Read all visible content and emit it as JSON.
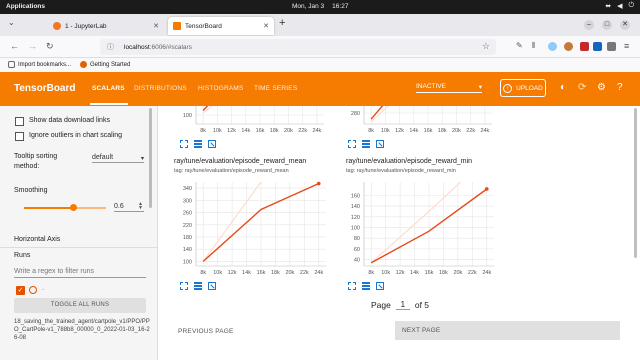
{
  "topbar": {
    "activities": "Applications",
    "date": "Mon, Jan 3",
    "time": "16:27"
  },
  "browser": {
    "tabs": [
      {
        "label": "1 - JupyterLab",
        "favicon_color": "#f37626"
      },
      {
        "label": "TensorBoard",
        "favicon_color": "#f57c00"
      }
    ],
    "url_host": "localhost",
    "url_rest": ":6006/#scalars",
    "bookmarks": [
      "Import bookmarks...",
      "Getting Started"
    ]
  },
  "header": {
    "brand": "TensorBoard",
    "nav": [
      "SCALARS",
      "DISTRIBUTIONS",
      "HISTOGRAMS",
      "TIME SERIES"
    ],
    "run_status": "INACTIVE",
    "upload_label": "UPLOAD"
  },
  "sidebar": {
    "show_download_links": "Show data download links",
    "ignore_outliers": "Ignore outliers in chart scaling",
    "tooltip_sorting_label": "Tooltip sorting method:",
    "tooltip_sorting_value": "default",
    "smoothing_label": "Smoothing",
    "smoothing_value": "0.6",
    "smoothing_fraction": 0.6,
    "horizontal_axis_label": "Horizontal Axis",
    "runs_label": "Runs",
    "runs_filter_placeholder": "Write a regex to filter runs",
    "runs_dots": ".",
    "toggle_all_runs": "TOGGLE ALL RUNS",
    "run_name": "18_saving_the_trained_agent/cartpole_v1/PPO/PPO_CartPole-v1_788b8_00000_0_2022-01-03_16-26-08"
  },
  "pagination": {
    "page_label": "Page",
    "page_value": "1",
    "of_label": "of 5",
    "prev_label": "PREVIOUS PAGE",
    "next_label": "NEXT PAGE"
  },
  "chart_data": [
    {
      "type": "line",
      "title": "",
      "x_ticks": [
        "8k",
        "10k",
        "12k",
        "14k",
        "16k",
        "18k",
        "20k",
        "22k",
        "24k"
      ],
      "y_ticks": [
        "100"
      ],
      "xlim": [
        7000,
        25000
      ],
      "ylim": [
        80,
        130
      ],
      "series": [
        {
          "x": [
            8000,
            9500
          ],
          "y": [
            108,
            132
          ],
          "color": "#e64a19"
        },
        {
          "x": [
            8000,
            10500
          ],
          "y": [
            103,
            132
          ],
          "color": "#ffd7c6"
        }
      ]
    },
    {
      "type": "line",
      "title": "",
      "x_ticks": [
        "8k",
        "10k",
        "12k",
        "14k",
        "16k",
        "18k",
        "20k",
        "22k",
        "24k"
      ],
      "y_ticks": [
        "280"
      ],
      "xlim": [
        7000,
        25000
      ],
      "ylim": [
        260,
        310
      ],
      "series": [
        {
          "x": [
            8000,
            10000
          ],
          "y": [
            270,
            305
          ],
          "color": "#e64a19"
        },
        {
          "x": [
            8000,
            11000
          ],
          "y": [
            265,
            305
          ],
          "color": "#ffd7c6"
        }
      ]
    },
    {
      "type": "line",
      "title": "ray/tune/evaluation/episode_reward_mean",
      "tag": "tag: ray/tune/evaluation/episode_reward_mean",
      "x_ticks": [
        "8k",
        "10k",
        "12k",
        "14k",
        "16k",
        "18k",
        "20k",
        "22k",
        "24k"
      ],
      "y_ticks": [
        "100",
        "140",
        "180",
        "220",
        "260",
        "300",
        "340"
      ],
      "xlim": [
        7000,
        25000
      ],
      "ylim": [
        85,
        360
      ],
      "series": [
        {
          "name": "smoothed",
          "x": [
            8000,
            16000,
            24000
          ],
          "y": [
            100,
            270,
            355
          ],
          "color": "#e64a19"
        },
        {
          "name": "raw",
          "x": [
            8000,
            16000,
            24000
          ],
          "y": [
            100,
            360,
            420
          ],
          "color": "#ffd7c6"
        }
      ]
    },
    {
      "type": "line",
      "title": "ray/tune/evaluation/episode_reward_min",
      "tag": "tag: ray/tune/evaluation/episode_reward_min",
      "x_ticks": [
        "8k",
        "10k",
        "12k",
        "14k",
        "16k",
        "18k",
        "20k",
        "22k",
        "24k"
      ],
      "y_ticks": [
        "40",
        "60",
        "80",
        "100",
        "120",
        "140",
        "160"
      ],
      "xlim": [
        7000,
        25000
      ],
      "ylim": [
        28,
        185
      ],
      "series": [
        {
          "name": "smoothed",
          "x": [
            8000,
            16000,
            24000
          ],
          "y": [
            34,
            93,
            172
          ],
          "color": "#e64a19"
        },
        {
          "name": "raw",
          "x": [
            8000,
            16000,
            24000
          ],
          "y": [
            34,
            130,
            230
          ],
          "color": "#ffd7c6"
        }
      ]
    }
  ]
}
